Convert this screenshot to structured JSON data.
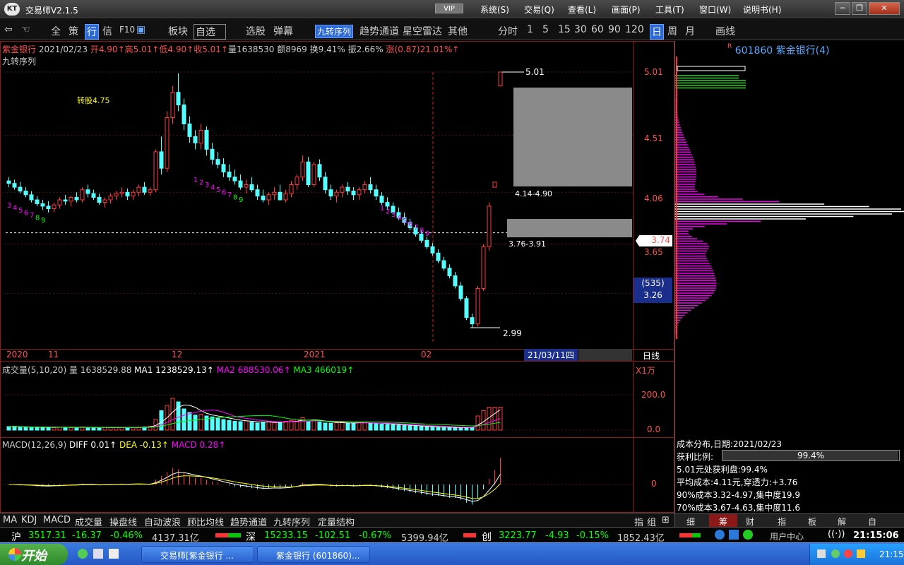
{
  "window": {
    "title": "交易师V2.1.5",
    "vip": "VIP",
    "menu": [
      "系统(S)",
      "交易(Q)",
      "查看(L)",
      "画面(P)",
      "工具(T)",
      "窗口(W)",
      "说明书(H)"
    ],
    "controls": [
      "─",
      "❐",
      "✕"
    ]
  },
  "toolbar": {
    "items": [
      "全",
      "策",
      "行",
      "信",
      "F10",
      "板块",
      "自选",
      "选股",
      "弹幕",
      "九转序列",
      "趋势通道",
      "星空雷达",
      "其他",
      "分时",
      "1",
      "5",
      "15",
      "30",
      "60",
      "90",
      "120",
      "日",
      "周",
      "月",
      "画线"
    ]
  },
  "price_header": {
    "name": "紫金银行",
    "date": "2021/02/23",
    "open": "开4.90↑",
    "high": "高5.01↑",
    "low": "低4.90↑",
    "close": "收5.01↑",
    "volume": "量1638530",
    "amount": "额8969",
    "turnover": "换9.41%",
    "amplitude": "振2.66%",
    "change": "涨(0.87)21.01%↑"
  },
  "overlay_label": "九转序列",
  "annotations": {
    "zhuangu": "转股4.75",
    "high_label": "5.01",
    "low_label": "2.99",
    "zone1": "4.14-4.90",
    "zone2": "3.76-3.91"
  },
  "y_axis": {
    "ticks": [
      "5.01",
      "4.51",
      "4.06",
      "3.65"
    ],
    "current": "3.74",
    "badge_count": "(535)",
    "badge_price": "3.26"
  },
  "x_axis": {
    "labels": [
      "2020",
      "11",
      "12",
      "2021",
      "02"
    ],
    "cursor_date": "21/03/11四",
    "period": "日线"
  },
  "volume_panel": {
    "title": "成交量(5,10,20)",
    "vol": "量 1638529.88",
    "ma1": "MA1 1238529.13↑",
    "ma2": "MA2 688530.06↑",
    "ma3": "MA3 466019↑",
    "unit": "X1万",
    "ticks": [
      "200.0",
      "0.0"
    ]
  },
  "macd_panel": {
    "title": "MACD(12,26,9)",
    "diff": "DIFF 0.01↑",
    "dea": "DEA -0.13↑",
    "macd": "MACD 0.28↑",
    "zero": "0"
  },
  "indicator_tabs": [
    "MA",
    "KDJ",
    "MACD",
    "成交量",
    "操盘线",
    "自动波浪",
    "顾比均线",
    "趋势通道",
    "九转序列",
    "定量结构"
  ],
  "indicator_tabs_right": [
    "指",
    "组"
  ],
  "right_panel": {
    "code": "601860",
    "name": "紫金银行(4)",
    "cost_title": "成本分布,日期:2021/02/23",
    "profit_label": "获利比例:",
    "profit_value": "99.4%",
    "profit_pct": 0.994,
    "lines": [
      "5.01元处获利盘:99.4%",
      "平均成本:4.11元,穿透力:+3.76",
      "90%成本3.32-4.97,集中度19.9",
      "70%成本3.67-4.63,集中度11.6"
    ],
    "tabs": [
      "细",
      "筹",
      "财",
      "指",
      "板",
      "解",
      "自"
    ]
  },
  "index_bar": {
    "sh_label": "沪",
    "sh": "3517.31",
    "sh_chg": "-16.37",
    "sh_pct": "-0.46%",
    "sh_amt": "4137.31亿",
    "sz_label": "深",
    "sz": "15233.15",
    "sz_chg": "-102.51",
    "sz_pct": "-0.67%",
    "sz_amt": "5399.94亿",
    "cy_label": "创",
    "cy": "3223.77",
    "cy_chg": "-4.93",
    "cy_pct": "-0.15%",
    "cy_amt": "1852.43亿",
    "user_center": "用户中心",
    "time": "21:15:06"
  },
  "taskbar": {
    "start": "开始",
    "tasks": [
      "交易师[紫金银行 ...",
      "紫金银行 (601860)..."
    ],
    "clock": "21:15"
  },
  "chart_data": {
    "type": "candlestick",
    "candles": [
      [
        4.15,
        4.18,
        4.1,
        4.13
      ],
      [
        4.13,
        4.16,
        4.08,
        4.1
      ],
      [
        4.1,
        4.14,
        4.05,
        4.07
      ],
      [
        4.07,
        4.1,
        4.02,
        4.04
      ],
      [
        4.04,
        4.07,
        3.98,
        4.0
      ],
      [
        4.0,
        4.03,
        3.95,
        3.97
      ],
      [
        3.97,
        4.0,
        3.92,
        3.95
      ],
      [
        3.95,
        3.99,
        3.9,
        3.93
      ],
      [
        3.93,
        3.98,
        3.9,
        3.96
      ],
      [
        3.96,
        4.02,
        3.93,
        4.0
      ],
      [
        4.0,
        4.04,
        3.96,
        3.99
      ],
      [
        3.99,
        4.03,
        3.95,
        4.02
      ],
      [
        4.02,
        4.06,
        3.98,
        4.0
      ],
      [
        4.0,
        4.1,
        3.98,
        4.08
      ],
      [
        4.08,
        4.12,
        4.02,
        4.05
      ],
      [
        4.05,
        4.08,
        4.0,
        4.02
      ],
      [
        4.02,
        4.05,
        3.96,
        3.98
      ],
      [
        3.98,
        4.02,
        3.94,
        4.0
      ],
      [
        4.0,
        4.05,
        3.97,
        4.03
      ],
      [
        4.03,
        4.07,
        4.0,
        4.05
      ],
      [
        4.05,
        4.1,
        4.02,
        4.06
      ],
      [
        4.06,
        4.09,
        4.0,
        4.03
      ],
      [
        4.03,
        4.08,
        4.0,
        4.06
      ],
      [
        4.06,
        4.12,
        4.03,
        4.1
      ],
      [
        4.1,
        4.14,
        4.04,
        4.06
      ],
      [
        4.06,
        4.1,
        4.03,
        4.08
      ],
      [
        4.08,
        4.4,
        4.06,
        4.38
      ],
      [
        4.38,
        4.5,
        4.2,
        4.25
      ],
      [
        4.25,
        4.7,
        4.22,
        4.65
      ],
      [
        4.65,
        4.9,
        4.6,
        4.85
      ],
      [
        4.85,
        5.0,
        4.7,
        4.75
      ],
      [
        4.75,
        4.8,
        4.55,
        4.6
      ],
      [
        4.6,
        4.66,
        4.45,
        4.5
      ],
      [
        4.5,
        4.55,
        4.4,
        4.45
      ],
      [
        4.45,
        4.6,
        4.4,
        4.55
      ],
      [
        4.55,
        4.58,
        4.35,
        4.4
      ],
      [
        4.4,
        4.45,
        4.28,
        4.32
      ],
      [
        4.32,
        4.38,
        4.25,
        4.28
      ],
      [
        4.28,
        4.33,
        4.18,
        4.22
      ],
      [
        4.22,
        4.28,
        4.15,
        4.18
      ],
      [
        4.18,
        4.24,
        4.12,
        4.15
      ],
      [
        4.15,
        4.2,
        4.08,
        4.1
      ],
      [
        4.1,
        4.16,
        4.05,
        4.12
      ],
      [
        4.12,
        4.18,
        4.06,
        4.08
      ],
      [
        4.08,
        4.12,
        4.0,
        4.03
      ],
      [
        4.03,
        4.08,
        3.98,
        4.0
      ],
      [
        4.0,
        4.06,
        3.96,
        4.04
      ],
      [
        4.04,
        4.1,
        4.0,
        4.06
      ],
      [
        4.06,
        4.12,
        4.02,
        4.0
      ],
      [
        4.0,
        4.08,
        3.98,
        4.05
      ],
      [
        4.05,
        4.15,
        4.02,
        4.12
      ],
      [
        4.12,
        4.2,
        4.08,
        4.18
      ],
      [
        4.18,
        4.35,
        4.15,
        4.3
      ],
      [
        4.3,
        4.34,
        4.1,
        4.12
      ],
      [
        4.12,
        4.3,
        4.1,
        4.28
      ],
      [
        4.28,
        4.32,
        4.15,
        4.18
      ],
      [
        4.18,
        4.22,
        4.05,
        4.08
      ],
      [
        4.08,
        4.12,
        4.0,
        4.03
      ],
      [
        4.03,
        4.08,
        3.98,
        4.06
      ],
      [
        4.06,
        4.12,
        4.02,
        4.1
      ],
      [
        4.1,
        4.14,
        4.04,
        4.07
      ],
      [
        4.07,
        4.1,
        4.0,
        4.04
      ],
      [
        4.04,
        4.1,
        4.0,
        4.08
      ],
      [
        4.08,
        4.15,
        4.05,
        4.12
      ],
      [
        4.12,
        4.18,
        4.05,
        4.08
      ],
      [
        4.08,
        4.12,
        4.0,
        4.03
      ],
      [
        4.03,
        4.06,
        3.96,
        3.98
      ],
      [
        3.98,
        4.02,
        3.92,
        3.95
      ],
      [
        3.95,
        3.98,
        3.88,
        3.9
      ],
      [
        3.9,
        3.94,
        3.84,
        3.86
      ],
      [
        3.86,
        3.9,
        3.8,
        3.82
      ],
      [
        3.82,
        3.85,
        3.76,
        3.78
      ],
      [
        3.78,
        3.8,
        3.71,
        3.73
      ],
      [
        3.73,
        3.76,
        3.66,
        3.68
      ],
      [
        3.68,
        3.71,
        3.61,
        3.63
      ],
      [
        3.63,
        3.66,
        3.56,
        3.58
      ],
      [
        3.58,
        3.61,
        3.5,
        3.52
      ],
      [
        3.52,
        3.55,
        3.44,
        3.46
      ],
      [
        3.46,
        3.49,
        3.38,
        3.4
      ],
      [
        3.4,
        3.43,
        3.3,
        3.32
      ],
      [
        3.32,
        3.35,
        3.2,
        3.22
      ],
      [
        3.22,
        3.24,
        3.05,
        3.07
      ],
      [
        3.07,
        3.1,
        2.99,
        3.02
      ],
      [
        3.02,
        3.32,
        3.0,
        3.3
      ],
      [
        3.3,
        3.65,
        3.28,
        3.63
      ],
      [
        3.63,
        3.98,
        3.6,
        3.95
      ],
      [
        4.1,
        4.14,
        4.1,
        4.14
      ],
      [
        4.9,
        5.01,
        4.9,
        5.01
      ]
    ],
    "volume": [
      20,
      22,
      18,
      16,
      15,
      14,
      18,
      16,
      14,
      17,
      15,
      14,
      16,
      18,
      15,
      14,
      13,
      15,
      16,
      14,
      15,
      16,
      14,
      17,
      18,
      22,
      60,
      110,
      140,
      180,
      160,
      120,
      100,
      85,
      90,
      80,
      75,
      70,
      60,
      55,
      50,
      48,
      52,
      45,
      40,
      44,
      48,
      42,
      46,
      50,
      55,
      60,
      70,
      48,
      55,
      46,
      40,
      38,
      42,
      45,
      40,
      38,
      42,
      44,
      40,
      36,
      34,
      32,
      30,
      28,
      26,
      24,
      22,
      20,
      18,
      18,
      16,
      16,
      15,
      14,
      14,
      16,
      16,
      80,
      110,
      130,
      130,
      130
    ],
    "macd": [
      0.0,
      0.0,
      -0.01,
      -0.01,
      -0.01,
      -0.02,
      -0.02,
      -0.02,
      -0.01,
      -0.01,
      0.0,
      0.0,
      0.0,
      0.01,
      0.0,
      0.0,
      -0.01,
      0.0,
      0.0,
      0.0,
      0.01,
      0.0,
      0.01,
      0.01,
      0.0,
      0.0,
      0.05,
      0.09,
      0.13,
      0.17,
      0.16,
      0.12,
      0.09,
      0.07,
      0.07,
      0.05,
      0.03,
      0.02,
      0.0,
      -0.01,
      -0.02,
      -0.03,
      -0.03,
      -0.04,
      -0.05,
      -0.05,
      -0.04,
      -0.03,
      -0.04,
      -0.03,
      -0.02,
      0.0,
      0.02,
      0.0,
      0.01,
      0.0,
      -0.01,
      -0.02,
      -0.02,
      -0.01,
      -0.01,
      -0.02,
      -0.01,
      0.0,
      -0.01,
      -0.02,
      -0.03,
      -0.04,
      -0.05,
      -0.06,
      -0.07,
      -0.08,
      -0.09,
      -0.1,
      -0.11,
      -0.12,
      -0.12,
      -0.13,
      -0.14,
      -0.14,
      -0.16,
      -0.19,
      -0.21,
      -0.15,
      -0.05,
      0.06,
      0.15,
      0.28
    ],
    "nine_count": [
      [
        "3",
        "4",
        "5",
        "6",
        "7",
        "8",
        "9"
      ],
      [
        "1",
        "2",
        "3",
        "4",
        "5",
        "6",
        "7",
        "8",
        "9"
      ],
      [
        "1",
        "2",
        "3",
        "4",
        "5",
        "6",
        "7",
        "8",
        "9"
      ]
    ],
    "colors": {
      "up": "#ff3c3c",
      "down": "#54ffff",
      "ma1": "#ffffff",
      "ma2": "#ff00ff",
      "ma3": "#00ff00"
    }
  }
}
